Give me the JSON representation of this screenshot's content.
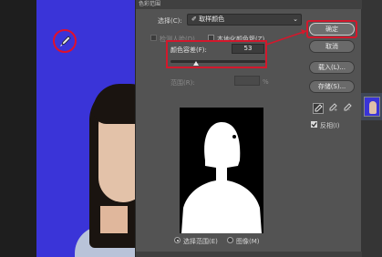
{
  "dialog": {
    "title": "色彩范围",
    "select_label": "选择(C):",
    "select_value": "取样颜色",
    "detect_faces_label": "检测人脸(D)",
    "localized_label": "本地化颜色簇(Z)",
    "fuzziness_label": "颜色容差(F):",
    "fuzziness_value": "53",
    "fuzziness_level_percent": 53,
    "range_label": "范围(R):",
    "range_unit": "%",
    "radio_selection_label": "选择范围(E)",
    "radio_image_label": "图像(M)"
  },
  "buttons": {
    "ok": "确定",
    "cancel": "取消",
    "load": "载入(L)...",
    "save": "存储(S)..."
  },
  "invert_label": "反相(I)",
  "colors": {
    "annotation_red": "#d3182c",
    "background_blue": "#3a34d8",
    "dialog_bg": "#535353"
  }
}
